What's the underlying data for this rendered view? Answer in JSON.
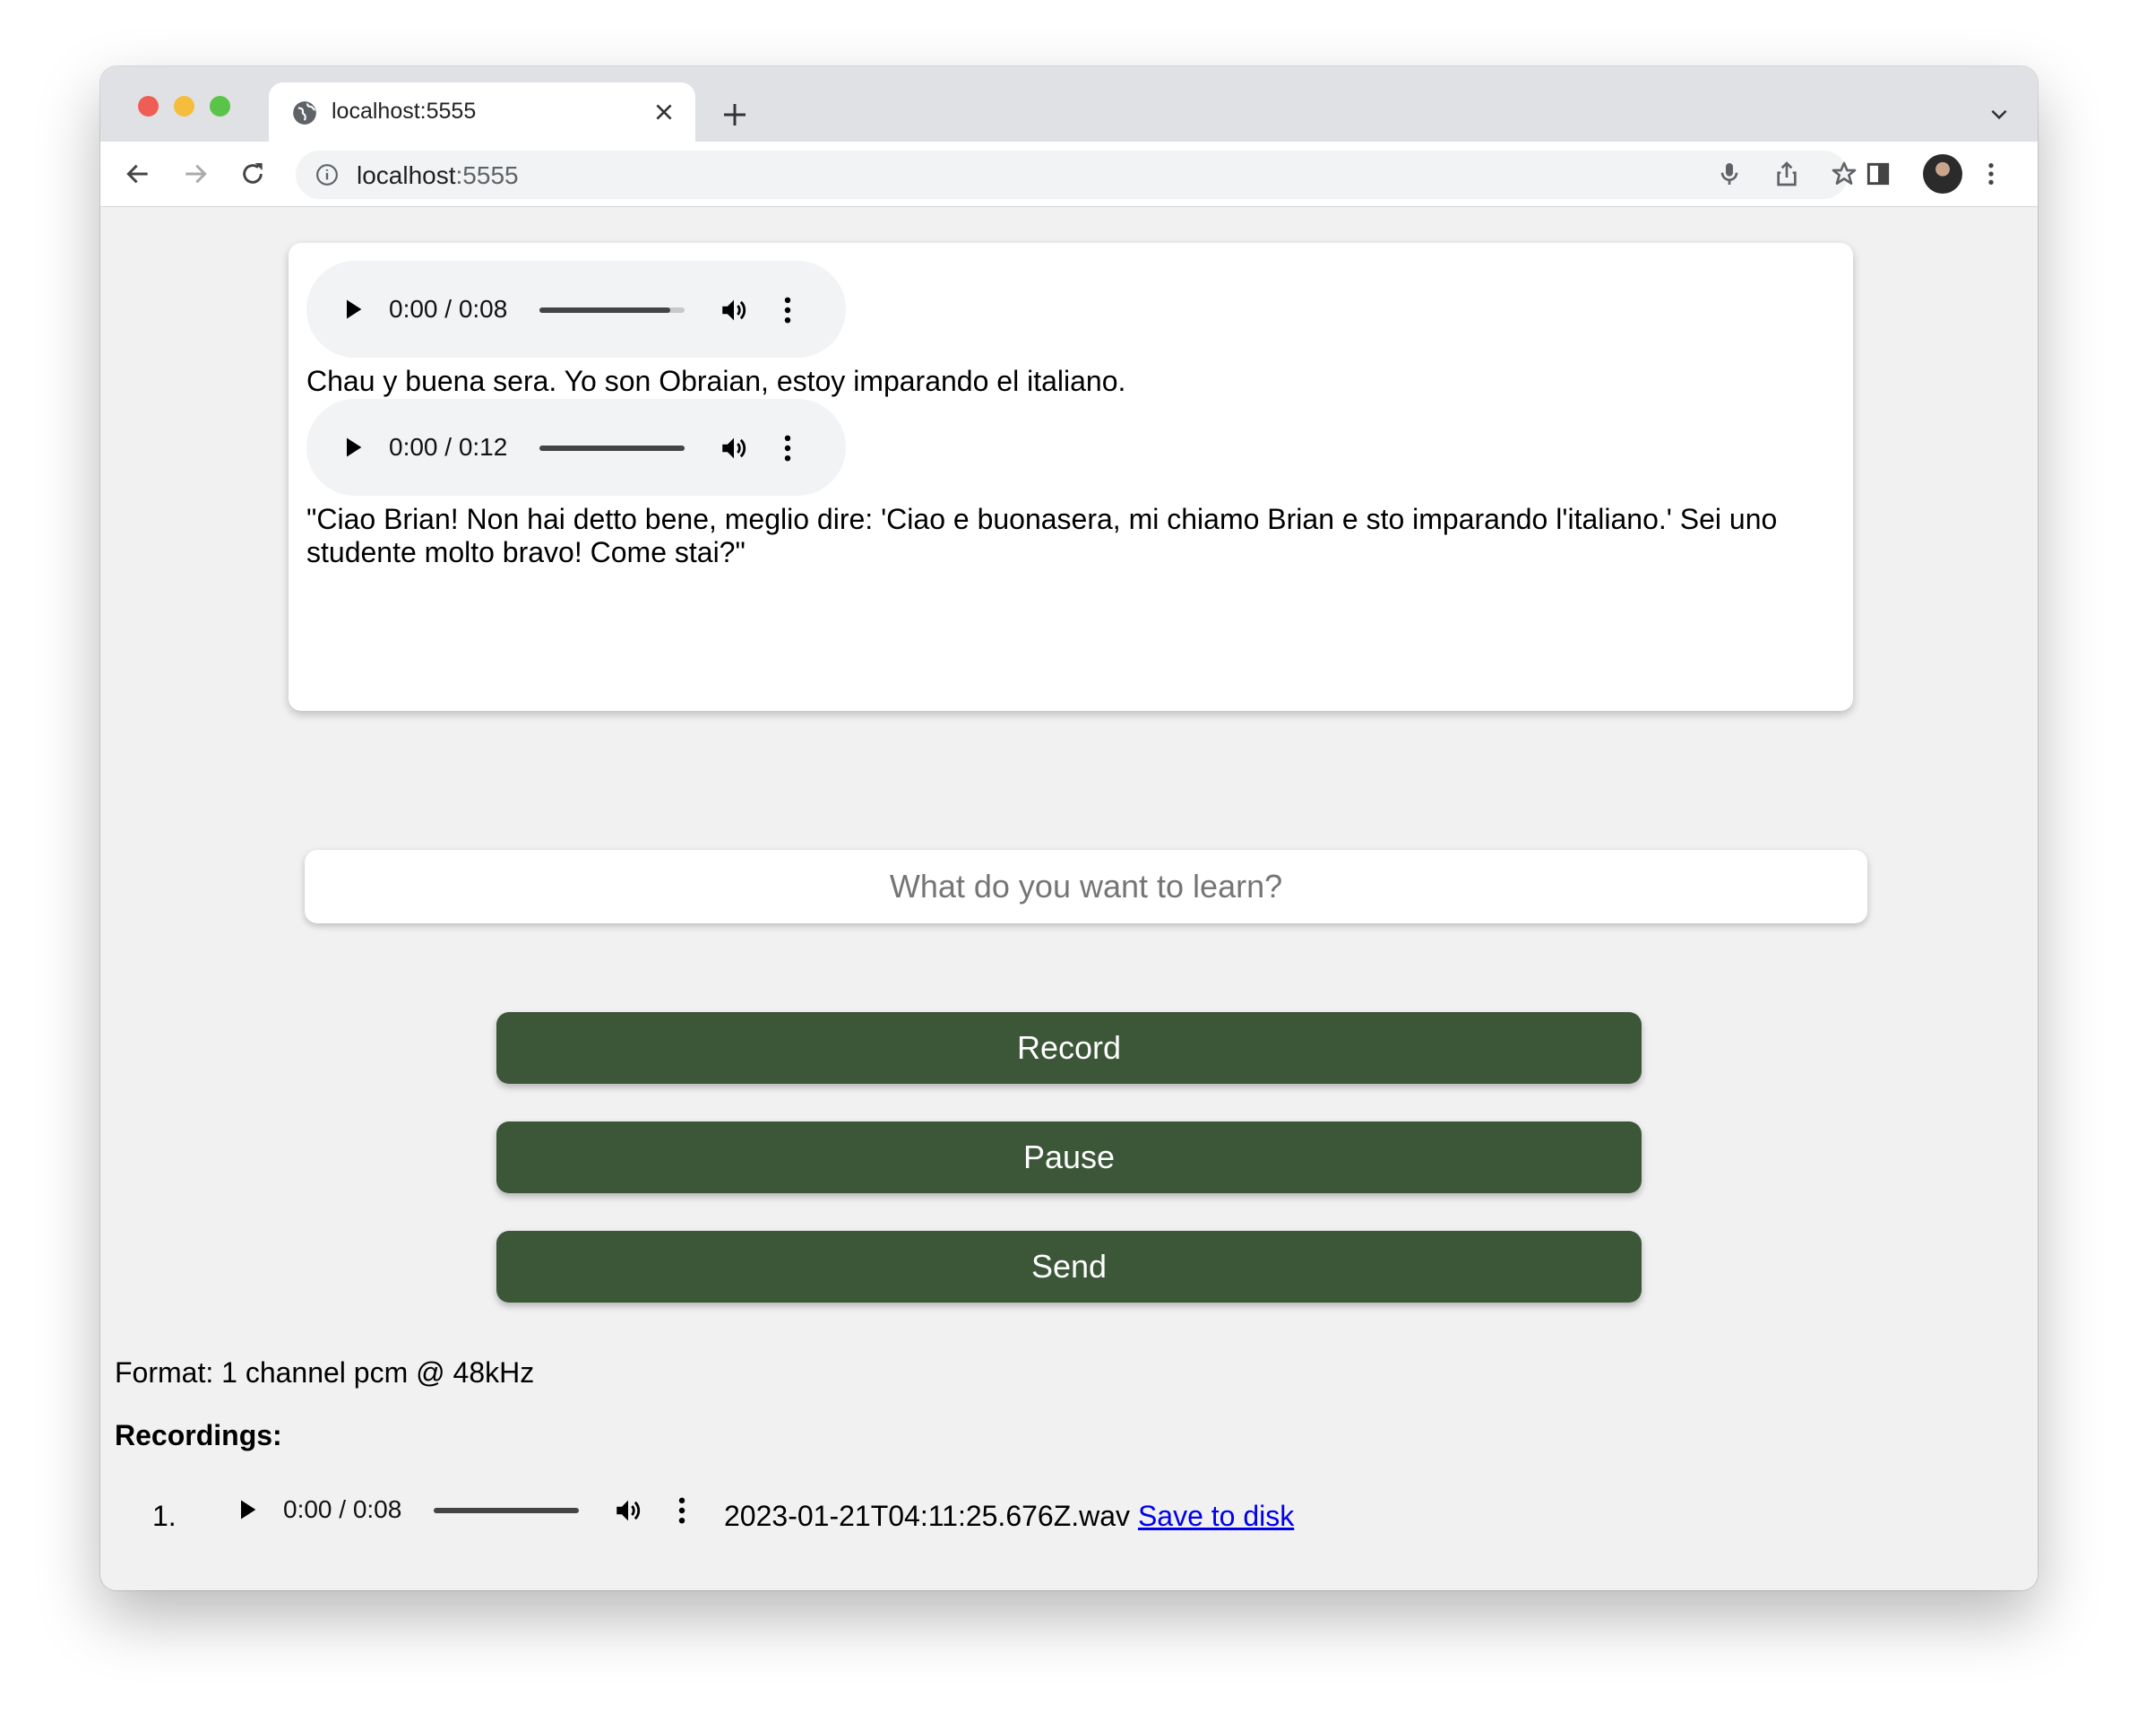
{
  "browser": {
    "tab_title": "localhost:5555",
    "url_host": "localhost",
    "url_port": ":5555"
  },
  "chat": {
    "messages": [
      {
        "audio_time": "0:00 / 0:08",
        "progress": 0.9,
        "text": "Chau y buena sera. Yo son Obraian, estoy imparando el italiano."
      },
      {
        "audio_time": "0:00 / 0:12",
        "progress": 1.0,
        "text": "\"Ciao Brian! Non hai detto bene, meglio dire: 'Ciao e buonasera, mi chiamo Brian e sto imparando l'italiano.' Sei uno studente molto bravo! Come stai?\""
      }
    ]
  },
  "learn_input": {
    "placeholder": "What do you want to learn?",
    "value": ""
  },
  "buttons": {
    "record": "Record",
    "pause": "Pause",
    "send": "Send"
  },
  "format_text": "Format: 1 channel pcm @ 48kHz",
  "recordings": {
    "heading": "Recordings:",
    "items": [
      {
        "number": "1.",
        "audio_time": "0:00 / 0:08",
        "progress": 1.0,
        "filename": "2023-01-21T04:11:25.676Z.wav",
        "link_text": "Save to disk"
      }
    ]
  },
  "colors": {
    "button_bg": "#3b5738",
    "link": "#0000ee"
  }
}
